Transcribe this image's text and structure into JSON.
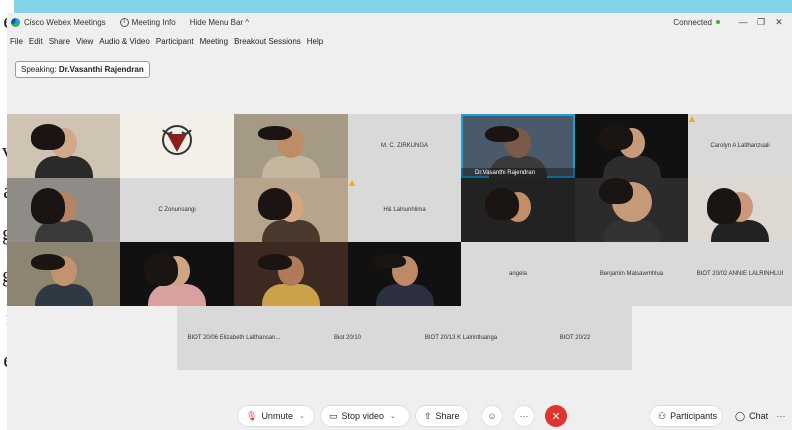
{
  "doc_margin": [
    "e",
    ",",
    "v",
    "a",
    "g",
    "g",
    "f",
    "e",
    "l"
  ],
  "titlebar": {
    "app_name": "Cisco Webex Meetings",
    "meeting_info": "Meeting Info",
    "hide_menu": "Hide Menu Bar ^",
    "status": "Connected",
    "minimize": "—",
    "restore": "❐",
    "close": "✕"
  },
  "menu": [
    "File",
    "Edit",
    "Share",
    "View",
    "Audio & Video",
    "Participant",
    "Meeting",
    "Breakout Sessions",
    "Help"
  ],
  "speaking": {
    "prefix": "Speaking:",
    "name": "Dr.Vasanthi Rajendran"
  },
  "tiles": {
    "mc": "M. C. ZIRKUNGA",
    "vasanthi": "Dr.Vasanthi Rajendran",
    "carolyn": "Carolyn A Lalthanzuali",
    "zonunsangi": "C Zonunsangi",
    "lalnunhlima": "H& Lalnunhlima",
    "angela": "angela",
    "benjamin": "Benjamin Malsawmhlua",
    "annie": "BIOT 20/02 ANNIE LALRINHLUI",
    "elizabeth": "BIOT 20/06 Elizabeth Lalthansan...",
    "biot10": "Biot 20/10",
    "lalrintluanga": "BIOT 20/13 K Lalrintluanga",
    "biot22": "BIOT 20/22"
  },
  "toolbar": {
    "unmute": "Unmute",
    "stop_video": "Stop video",
    "share": "Share",
    "participants": "Participants",
    "chat": "Chat",
    "more": "···"
  },
  "colors": {
    "accent": "#1ba0d7",
    "leave": "#e0332e",
    "background": "#7fd4ea"
  }
}
